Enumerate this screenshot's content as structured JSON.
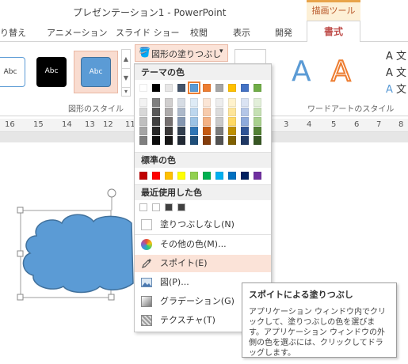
{
  "window": {
    "title": "プレゼンテーション1 - PowerPoint",
    "context_group": "描画ツール"
  },
  "tabs": [
    "り替え",
    "アニメーション",
    "スライド ショー",
    "校閲",
    "表示",
    "開発"
  ],
  "active_tab": "書式",
  "ribbon": {
    "shape_styles": [
      "Abc",
      "Abc",
      "Abc"
    ],
    "fill_button": "図形の塗りつぶし",
    "group_shape_styles": "図形のスタイル",
    "group_wordart": "ワードアートのスタイル",
    "wordart_sample": "A",
    "text_buttons": [
      "文",
      "文",
      "文"
    ]
  },
  "ruler": [
    "16",
    "15",
    "14",
    "13",
    "12",
    "11",
    "3",
    "4",
    "5",
    "6",
    "7",
    "8"
  ],
  "menu": {
    "theme_header": "テーマの色",
    "standard_header": "標準の色",
    "recent_header": "最近使用した色",
    "items": [
      {
        "label": "塗りつぶしなし(N)",
        "icon": "no-fill-icon"
      },
      {
        "label": "その他の色(M)...",
        "icon": "color-wheel-icon"
      },
      {
        "label": "スポイト(E)",
        "icon": "eyedropper-icon"
      },
      {
        "label": "図(P)...",
        "icon": "picture-icon"
      },
      {
        "label": "グラデーション(G)",
        "icon": "gradient-icon"
      },
      {
        "label": "テクスチャ(T)",
        "icon": "texture-icon"
      }
    ],
    "theme_top": [
      "#ffffff",
      "#000000",
      "#e7e6e6",
      "#44546a",
      "#5b9bd5",
      "#ed7d31",
      "#a5a5a5",
      "#ffc000",
      "#4472c4",
      "#70ad47"
    ],
    "theme_shades": [
      [
        "#f2f2f2",
        "#7f7f7f",
        "#d0cece",
        "#d6dce4",
        "#deebf6",
        "#fbe5d5",
        "#ededed",
        "#fff2cc",
        "#dae3f3",
        "#e2efd9"
      ],
      [
        "#d8d8d8",
        "#595959",
        "#aeabab",
        "#adb9ca",
        "#bdd7ee",
        "#f7cbac",
        "#dbdbdb",
        "#fee599",
        "#b4c6e7",
        "#c5e0b3"
      ],
      [
        "#bfbfbf",
        "#3f3f3f",
        "#757070",
        "#8496b0",
        "#9cc3e5",
        "#f4b183",
        "#c9c9c9",
        "#ffd965",
        "#8eaadb",
        "#a8d08d"
      ],
      [
        "#a5a5a5",
        "#262626",
        "#3a3838",
        "#323f4f",
        "#2e75b5",
        "#c55a11",
        "#7b7b7b",
        "#bf9000",
        "#2f5496",
        "#538135"
      ],
      [
        "#7f7f7f",
        "#0c0c0c",
        "#171616",
        "#222a35",
        "#1e4e79",
        "#833c0b",
        "#525252",
        "#7f6000",
        "#1f3864",
        "#375623"
      ]
    ],
    "standard": [
      "#c00000",
      "#ff0000",
      "#ffc000",
      "#ffff00",
      "#92d050",
      "#00b050",
      "#00b0f0",
      "#0070c0",
      "#002060",
      "#7030a0"
    ],
    "recent": [
      "#ffffff",
      "#ffffff",
      "#404040",
      "#404040"
    ],
    "selected_color": "#5b9bd5"
  },
  "tooltip": {
    "title": "スポイトによる塗りつぶし",
    "body": "アプリケーション ウィンドウ内でクリックして、塗りつぶしの色を選びます。アプリケーション ウィンドウの外側の色を選ぶには、クリックしてドラッグします。"
  },
  "shape": {
    "fill": "#5b9bd5",
    "stroke": "#41719c"
  }
}
